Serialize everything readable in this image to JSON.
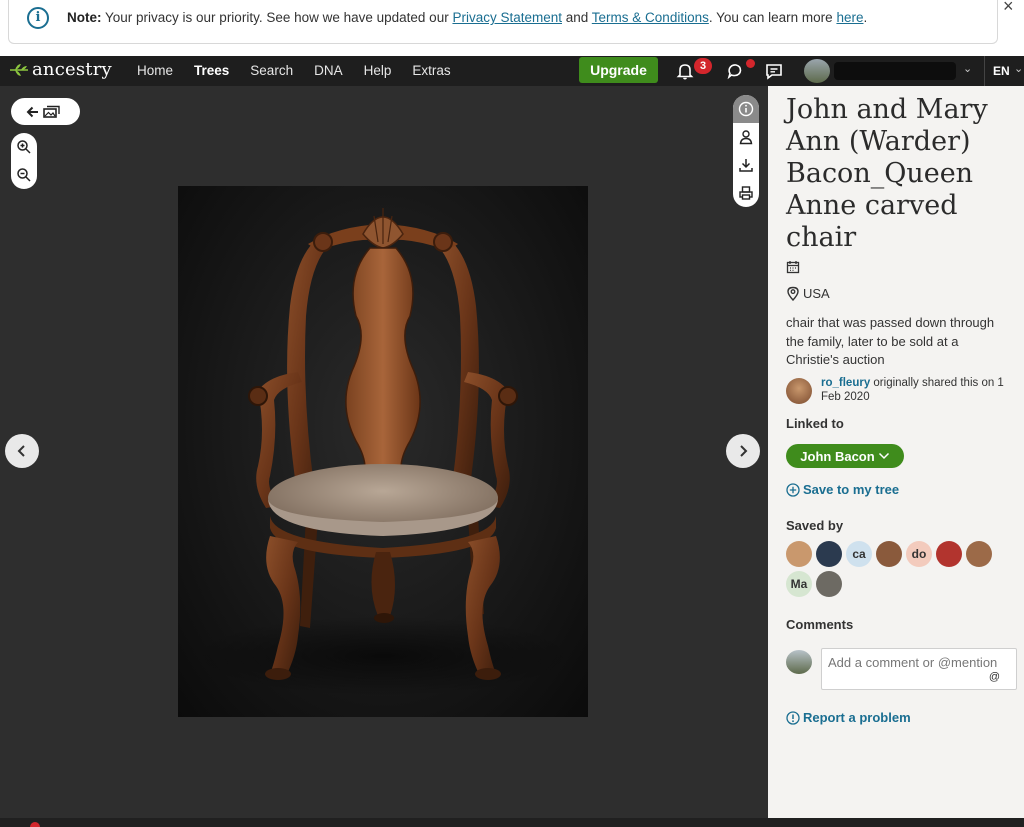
{
  "note": {
    "label": "Note:",
    "text_before": " Your privacy is our priority. See how we have updated our ",
    "privacy_link": "Privacy Statement",
    "and": " and ",
    "terms_link": "Terms & Conditions",
    "text_after": ". You can learn more ",
    "here_link": "here",
    "period": ".",
    "close": "×"
  },
  "nav": {
    "logo": "ancestry",
    "links": [
      "Home",
      "Trees",
      "Search",
      "DNA",
      "Help",
      "Extras"
    ],
    "active_link": "Trees",
    "upgrade": "Upgrade",
    "notification_count": "3",
    "language": "EN"
  },
  "viewer": {
    "icons": [
      "back-to-gallery-icon",
      "zoom-in-icon",
      "zoom-out-icon",
      "info-icon",
      "person-icon",
      "download-icon",
      "print-icon",
      "chevron-left-icon",
      "chevron-right-icon"
    ]
  },
  "panel": {
    "title": "John and Mary Ann (Warder) Bacon_Queen Anne carved chair",
    "location": "USA",
    "description": "chair that was passed down through the family, later to be sold at a Christie's auction",
    "shared_user": "ro_fleury",
    "shared_text": " originally shared this on 1 Feb 2020",
    "linked_to_label": "Linked to",
    "linked_person": "John Bacon",
    "save_to_tree": "Save to my tree",
    "saved_by_label": "Saved by",
    "saved_by": [
      {
        "initials": "",
        "color": "#c9986d"
      },
      {
        "initials": "",
        "color": "#2b3a4f"
      },
      {
        "initials": "ca",
        "color": "#cfe1ee"
      },
      {
        "initials": "",
        "color": "#8a5a3c"
      },
      {
        "initials": "do",
        "color": "#f3cbbd"
      },
      {
        "initials": "",
        "color": "#b2342e"
      },
      {
        "initials": "",
        "color": "#9c6a48"
      },
      {
        "initials": "Ma",
        "color": "#d6e6d1"
      },
      {
        "initials": "",
        "color": "#6d6a63"
      }
    ],
    "comments_label": "Comments",
    "comment_placeholder": "Add a comment or @mention",
    "comment_at": "@",
    "report": "Report a problem"
  },
  "colors": {
    "brand_green": "#3f8c1c",
    "link_blue": "#1a6e91",
    "nav_bg": "#1e1e1e",
    "viewer_bg": "#2e2e2e",
    "badge_red": "#d3262c"
  }
}
